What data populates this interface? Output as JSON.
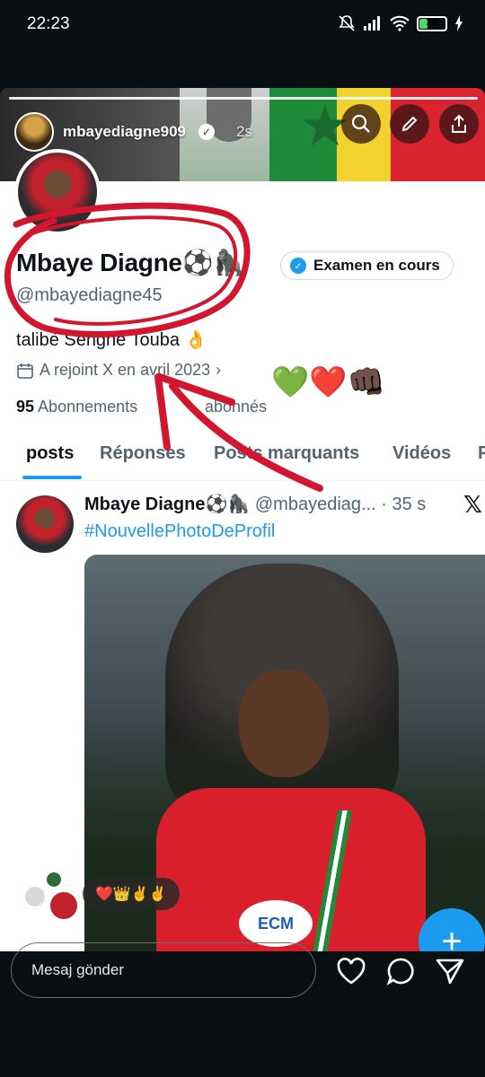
{
  "status": {
    "time": "22:23",
    "battery": "28"
  },
  "story": {
    "username": "mbayediagne909",
    "age": "2s",
    "message_placeholder": "Mesaj gönder",
    "reply_reaction": "❤️👑✌️✌️"
  },
  "profile": {
    "display_name": "Mbaye Diagne⚽🦍",
    "handle": "@mbayediagne45",
    "badge_label": "Examen en cours",
    "bio": "talibè Serigne Touba 👌",
    "joined": "A rejoint X en avril 2023",
    "following_count": "95",
    "following_label": "Abonnements",
    "followers_label": "abonnés",
    "sticker": "💚❤️👊🏿"
  },
  "tabs": [
    "posts",
    "Réponses",
    "Posts marquants",
    "Vidéos",
    "P"
  ],
  "tweet": {
    "name": "Mbaye Diagne⚽🦍",
    "handle_time": "@mbayediag... · 35 s",
    "hashtag": "#NouvellePhotoDeProfil",
    "sponsor": "ECM"
  },
  "colors": {
    "accent": "#1d9bf0",
    "annotation": "#d4152e"
  }
}
